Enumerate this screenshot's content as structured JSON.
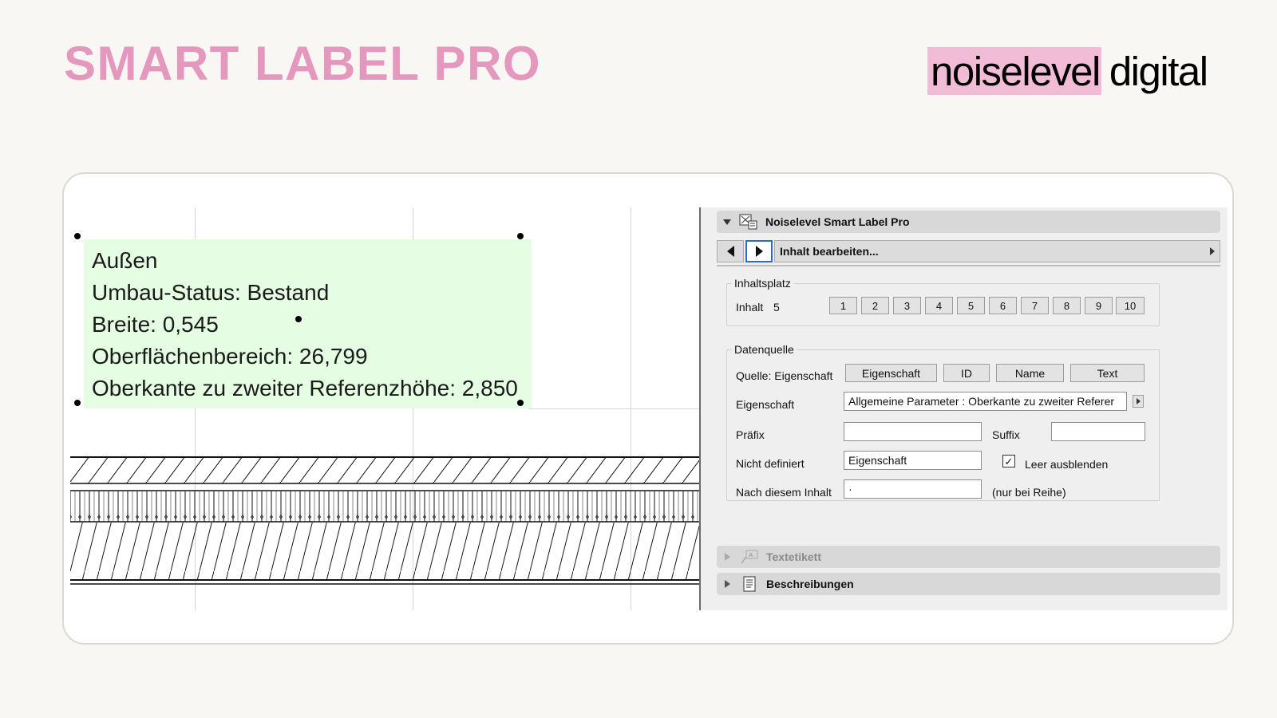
{
  "slide": {
    "title": "SMART LABEL PRO",
    "logo": {
      "highlight": "noiselevel",
      "rest": "digital"
    }
  },
  "label": {
    "lines": [
      "Außen",
      "Umbau-Status: Bestand",
      "Breite: 0,545",
      "Oberflächenbereich: 26,799",
      "Oberkante zu zweiter Referenzhöhe: 2,850"
    ]
  },
  "panel": {
    "header": {
      "title": "Noiselevel Smart Label Pro",
      "icon": "smart-label-icon"
    },
    "nav": {
      "field_label": "Inhalt bearbeiten..."
    },
    "inhaltsplatz": {
      "title": "Inhaltsplatz",
      "inhalt_label": "Inhalt",
      "inhalt_value": "5",
      "buttons": [
        "1",
        "2",
        "3",
        "4",
        "5",
        "6",
        "7",
        "8",
        "9",
        "10"
      ]
    },
    "datenquelle": {
      "title": "Datenquelle",
      "quelle_label": "Quelle: Eigenschaft",
      "source_buttons": [
        "Eigenschaft",
        "ID",
        "Name",
        "Text"
      ],
      "eigenschaft_label": "Eigenschaft",
      "eigenschaft_value": "Allgemeine Parameter : Oberkante zu zweiter Referer",
      "praefix_label": "Präfix",
      "praefix_value": "",
      "suffix_label": "Suffix",
      "suffix_value": "",
      "nicht_definiert_label": "Nicht definiert",
      "nicht_definiert_value": "Eigenschaft",
      "leer_ausblenden_label": "Leer ausblenden",
      "leer_ausblenden_checked": true,
      "nach_inhalt_label": "Nach diesem Inhalt",
      "nach_inhalt_value": "·",
      "nur_reihe_label": "(nur bei Reihe)"
    },
    "textetikett": {
      "title": "Textetikett",
      "icon": "text-label-icon"
    },
    "beschreibungen": {
      "title": "Beschreibungen",
      "icon": "document-icon"
    }
  }
}
